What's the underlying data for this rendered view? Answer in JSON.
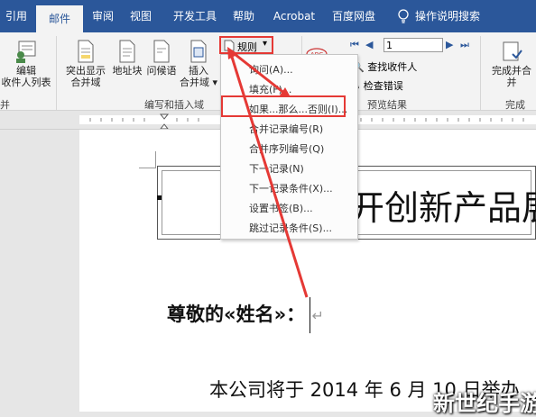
{
  "tabs": [
    "引用",
    "邮件",
    "审阅",
    "视图",
    "开发工具",
    "帮助",
    "Acrobat",
    "百度网盘",
    "操作说明搜索"
  ],
  "ribbon": {
    "edit_recipients": [
      "编辑",
      "收件人列表"
    ],
    "highlight_merge": [
      "突出显示",
      "合并域"
    ],
    "address_block": "地址块",
    "greeting_line": "问候语",
    "insert_merge": [
      "插入",
      "合并域"
    ],
    "rules": "规则",
    "record_nav_value": "1",
    "find_recipient": "查找收件人",
    "check_errors": "检查错误",
    "finish_merge": [
      "完成并合",
      "并"
    ],
    "group_write": "编写和插入域",
    "group_preview": "预览结果",
    "group_finish": "完成",
    "group_left": "并"
  },
  "menu": {
    "items": [
      "询问(A)...",
      "填充(F)...",
      "如果...那么...否则(I)...",
      "合并记录编号(R)",
      "合并序列编号(Q)",
      "下一记录(N)",
      "下一记录条件(X)...",
      "设置书签(B)...",
      "跳过记录条件(S)..."
    ]
  },
  "document": {
    "title": "开创新产品展",
    "greeting": "尊敬的«姓名»：",
    "body": "本公司将于 2014 年 6 月 10 日举办"
  },
  "watermark": "新世纪手游",
  "colors": {
    "accent": "#2b579a",
    "highlight": "#e53935"
  }
}
